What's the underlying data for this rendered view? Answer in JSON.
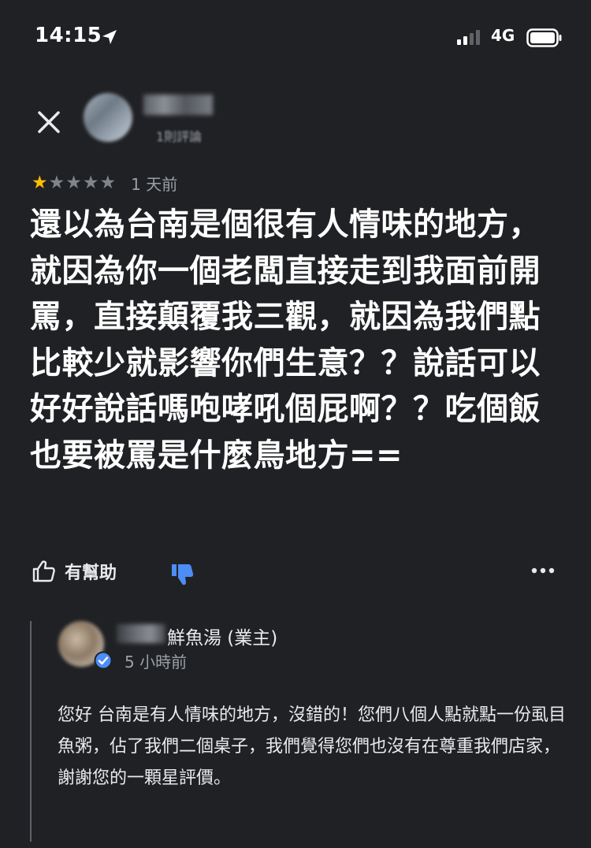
{
  "status_bar": {
    "time": "14:15",
    "network": "4G"
  },
  "review": {
    "reviewer_meta": "1則評論",
    "rating": 1,
    "max_rating": 5,
    "time": "1 天前",
    "text": "還以為台南是個很有人情味的地方，就因為你一個老闆直接走到我面前開罵，直接顛覆我三觀，就因為我們點比較少就影響你們生意？？說話可以好好說話嗎咆哮吼個屁啊？？吃個飯也要被罵是什麼鳥地方==",
    "helpful_label": "有幫助"
  },
  "owner_reply": {
    "name": "鮮魚湯 (業主)",
    "time": "5 小時前",
    "text": "您好 台南是有人情味的地方，沒錯的！您們八個人點就點一份虱目魚粥，佔了我們二個桌子，我們覺得您們也沒有在尊重我們店家，謝謝您的一顆星評價。"
  },
  "colors": {
    "background": "#202124",
    "star_filled": "#fbbc04",
    "star_empty": "#808589",
    "accent_blue": "#4c8df6"
  }
}
